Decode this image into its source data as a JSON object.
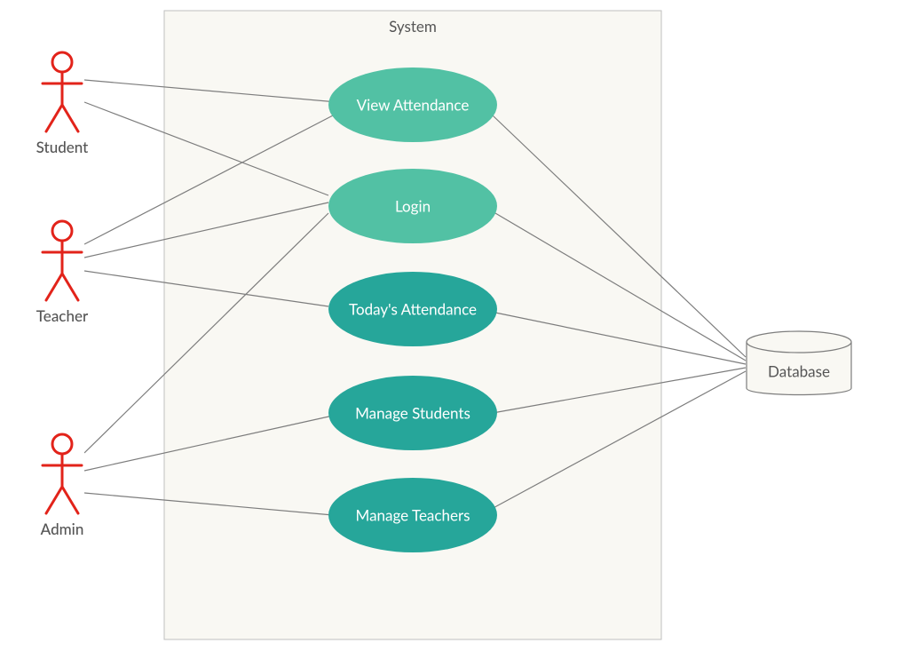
{
  "system": {
    "title": "System"
  },
  "actors": {
    "student": {
      "label": "Student"
    },
    "teacher": {
      "label": "Teacher"
    },
    "admin": {
      "label": "Admin"
    }
  },
  "usecases": {
    "view_attendance": {
      "label": "View Attendance"
    },
    "login": {
      "label": "Login"
    },
    "todays_attendance": {
      "label": "Today's Attendance"
    },
    "manage_students": {
      "label": "Manage Students"
    },
    "manage_teachers": {
      "label": "Manage Teachers"
    }
  },
  "external": {
    "database": {
      "label": "Database"
    }
  },
  "associations": {
    "actor_usecase": [
      [
        "student",
        "view_attendance"
      ],
      [
        "student",
        "login"
      ],
      [
        "teacher",
        "view_attendance"
      ],
      [
        "teacher",
        "login"
      ],
      [
        "teacher",
        "todays_attendance"
      ],
      [
        "admin",
        "login"
      ],
      [
        "admin",
        "manage_students"
      ],
      [
        "admin",
        "manage_teachers"
      ]
    ],
    "usecase_database": [
      "view_attendance",
      "login",
      "todays_attendance",
      "manage_students",
      "manage_teachers"
    ]
  },
  "colors": {
    "usecase_light": "#52c1a4",
    "usecase_dark": "#26a69a",
    "actor_stroke": "#e2231a",
    "system_fill": "#f9f8f3",
    "line": "#7d7d7d"
  }
}
